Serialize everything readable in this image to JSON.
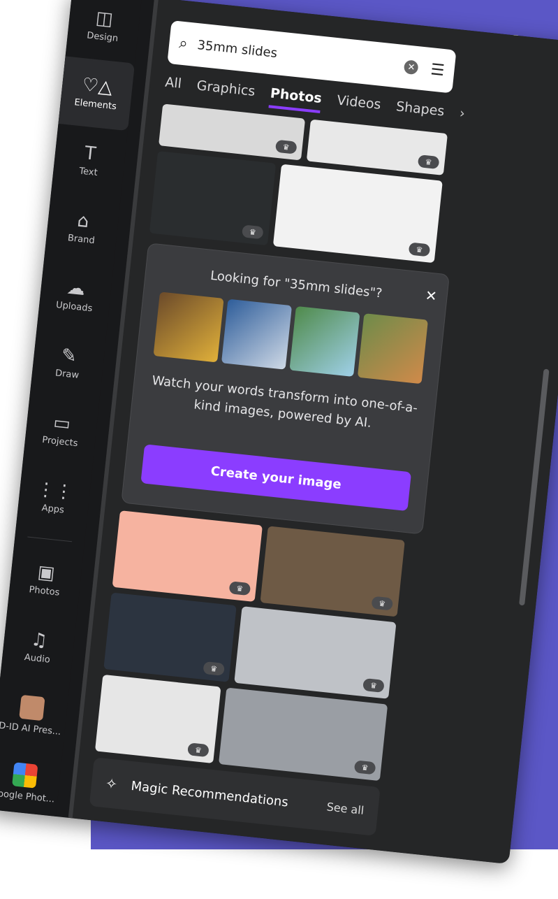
{
  "rail": {
    "items": [
      {
        "label": "Design",
        "icon": "layout-icon",
        "glyph": "◫"
      },
      {
        "label": "Elements",
        "icon": "shapes-icon",
        "glyph": "♡△",
        "active": true
      },
      {
        "label": "Text",
        "icon": "text-icon",
        "glyph": "T"
      },
      {
        "label": "Brand",
        "icon": "brand-icon",
        "glyph": "⌂"
      },
      {
        "label": "Uploads",
        "icon": "upload-cloud-icon",
        "glyph": "☁"
      },
      {
        "label": "Draw",
        "icon": "draw-icon",
        "glyph": "✎"
      },
      {
        "label": "Projects",
        "icon": "folder-icon",
        "glyph": "▭"
      },
      {
        "label": "Apps",
        "icon": "apps-grid-icon",
        "glyph": "⋮⋮"
      }
    ],
    "apps": [
      {
        "label": "Photos",
        "icon": "image-icon",
        "glyph": "▣"
      },
      {
        "label": "Audio",
        "icon": "music-icon",
        "glyph": "♫"
      },
      {
        "label": "D-ID AI Pres...",
        "icon": "avatar-app-icon"
      },
      {
        "label": "Google Phot...",
        "icon": "google-photos-icon"
      }
    ]
  },
  "search": {
    "value": "35mm slides",
    "icons": {
      "search": "search-icon",
      "clear": "clear-icon",
      "filter": "filter-icon"
    }
  },
  "tabs": [
    "All",
    "Graphics",
    "Photos",
    "Videos",
    "Shapes"
  ],
  "active_tab": "Photos",
  "promo": {
    "title": "Looking for \"35mm slides\"?",
    "description": "Watch your words transform into one-of-a-kind images, powered by AI.",
    "cta": "Create your image",
    "images": [
      "#d9a33b",
      "#5b8bc7",
      "#6fa86b",
      "#c47a43"
    ]
  },
  "magic": {
    "label": "Magic Recommendations",
    "see_all": "See all"
  },
  "colors": {
    "background": "#5b57c6",
    "accent": "#8b3dff",
    "panel": "#18191b"
  }
}
